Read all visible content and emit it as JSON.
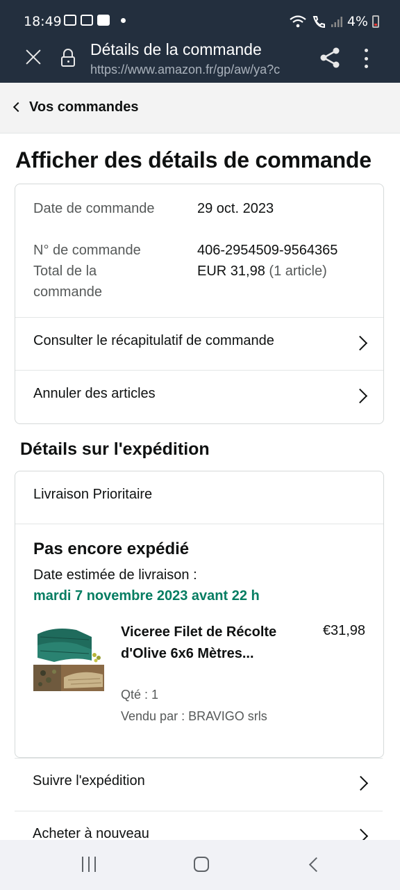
{
  "status_bar": {
    "time": "18:49",
    "battery": "4%"
  },
  "toolbar": {
    "title": "Détails de la commande",
    "url": "https://www.amazon.fr/gp/aw/ya?c"
  },
  "breadcrumb": {
    "label": "Vos commandes"
  },
  "page": {
    "title": "Afficher des détails de commande"
  },
  "order_info": {
    "rows": [
      {
        "label": "Date de commande",
        "value": "29 oct. 2023"
      },
      {
        "label": "N° de commande",
        "value": "406-2954509-9564365"
      },
      {
        "label": "Total de la commande",
        "value": "EUR 31,98",
        "value_extra": "(1 article)"
      }
    ],
    "links": [
      {
        "label": "Consulter le récapitulatif de commande"
      },
      {
        "label": "Annuler des articles"
      }
    ]
  },
  "shipment": {
    "section_title": "Détails sur l'expédition",
    "method": "Livraison Prioritaire",
    "status": "Pas encore expédié",
    "eta_label": "Date estimée de livraison :",
    "eta_value": "mardi 7 novembre 2023 avant 22 h",
    "eta_color": "#067d62",
    "item": {
      "title": "Viceree Filet de Récolte d'Olive 6x6 Mètres...",
      "price": "€31,98",
      "qty": "Qté : 1",
      "seller": "Vendu par : BRAVIGO srls"
    },
    "links": [
      {
        "label": "Suivre l'expédition"
      },
      {
        "label": "Acheter à nouveau"
      }
    ]
  },
  "colors": {
    "header_bg": "#232f3e",
    "breadcrumb_bg": "#f3f3f3",
    "text": "#0f1111"
  }
}
